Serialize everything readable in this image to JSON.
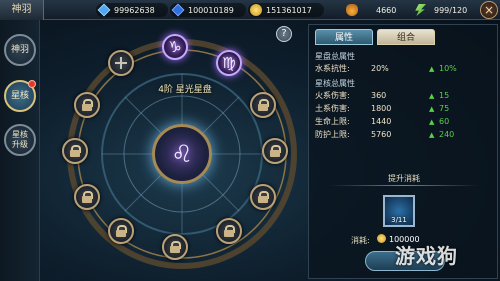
{
  "header": {
    "title": "神羽",
    "close_label": "×"
  },
  "resources": [
    {
      "icon": "diamond-icon",
      "value": "99962638"
    },
    {
      "icon": "blue-gem-icon",
      "value": "100010189"
    },
    {
      "icon": "gold-coin-icon",
      "value": "151361017"
    },
    {
      "icon": "potion-icon",
      "value": "4660"
    },
    {
      "icon": "energy-icon",
      "value": "999/120"
    }
  ],
  "sidebar": {
    "items": [
      {
        "label": "神羽"
      },
      {
        "label": "星核"
      },
      {
        "label": "星核升级"
      }
    ]
  },
  "help_label": "?",
  "constellation": {
    "title": "4阶 星光星盘",
    "center_symbol": "♌",
    "nodes": [
      {
        "symbol": "♑",
        "state": "active"
      },
      {
        "symbol": "♍",
        "state": "active"
      },
      {
        "symbol": "",
        "state": "locked"
      },
      {
        "symbol": "",
        "state": "locked"
      },
      {
        "symbol": "",
        "state": "locked"
      },
      {
        "symbol": "",
        "state": "locked"
      },
      {
        "symbol": "",
        "state": "locked"
      },
      {
        "symbol": "",
        "state": "locked"
      },
      {
        "symbol": "",
        "state": "locked"
      },
      {
        "symbol": "",
        "state": "locked"
      },
      {
        "symbol": "",
        "state": "locked"
      },
      {
        "symbol": "",
        "state": "locked"
      }
    ]
  },
  "panel": {
    "tabs": [
      "属性",
      "组合"
    ],
    "section1_title": "星盘总属性",
    "section1_stats": [
      {
        "name": "水系抗性:",
        "value": "20%",
        "gain": "10%"
      }
    ],
    "section2_title": "星核总属性",
    "section2_stats": [
      {
        "name": "火系伤害:",
        "value": "360",
        "gain": "15"
      },
      {
        "name": "土系伤害:",
        "value": "1800",
        "gain": "75"
      },
      {
        "name": "生命上限:",
        "value": "1440",
        "gain": "60"
      },
      {
        "name": "防护上限:",
        "value": "5760",
        "gain": "240"
      }
    ],
    "upgrade_title": "提升消耗",
    "item_count": "3/11",
    "cost_label": "消耗:",
    "cost_value": "100000"
  },
  "watermark": "游戏狗",
  "colors": {
    "accent_gold": "#b9a27a",
    "gain_green": "#57d04a",
    "tab_active": "#2d5a72"
  }
}
